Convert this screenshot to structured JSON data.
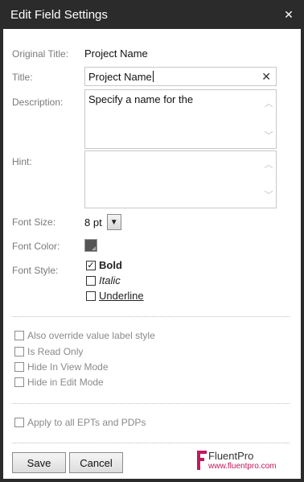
{
  "dialog": {
    "title": "Edit Field Settings",
    "close_glyph": "✕"
  },
  "form": {
    "original_title_label": "Original Title:",
    "original_title_value": "Project Name",
    "title_label": "Title:",
    "title_value": "Project Name",
    "title_clear_glyph": "✕",
    "description_label": "Description:",
    "description_value": "Specify a name for the",
    "hint_label": "Hint:",
    "hint_value": "",
    "font_size_label": "Font Size:",
    "font_size_value": "8 pt",
    "font_color_label": "Font Color:",
    "font_color_value": "#555555",
    "font_style_label": "Font Style:",
    "styles": [
      {
        "label": "Bold",
        "checked": true
      },
      {
        "label": "Italic",
        "checked": false
      },
      {
        "label": "Underline",
        "checked": false
      }
    ]
  },
  "options": [
    {
      "label": "Also override value label style",
      "checked": false
    },
    {
      "label": "Is Read Only",
      "checked": false
    },
    {
      "label": "Hide In View Mode",
      "checked": false
    },
    {
      "label": "Hide in Edit Mode",
      "checked": false
    }
  ],
  "apply_all": {
    "label": "Apply to all EPTs and PDPs",
    "checked": false
  },
  "buttons": {
    "save": "Save",
    "cancel": "Cancel"
  },
  "logo": {
    "name": "FluentPro",
    "url": "www.fluentpro.com"
  },
  "icons": {
    "scroll_up": "chevron-up-icon",
    "scroll_down": "chevron-down-icon",
    "dropdown": "chevron-down-icon"
  }
}
